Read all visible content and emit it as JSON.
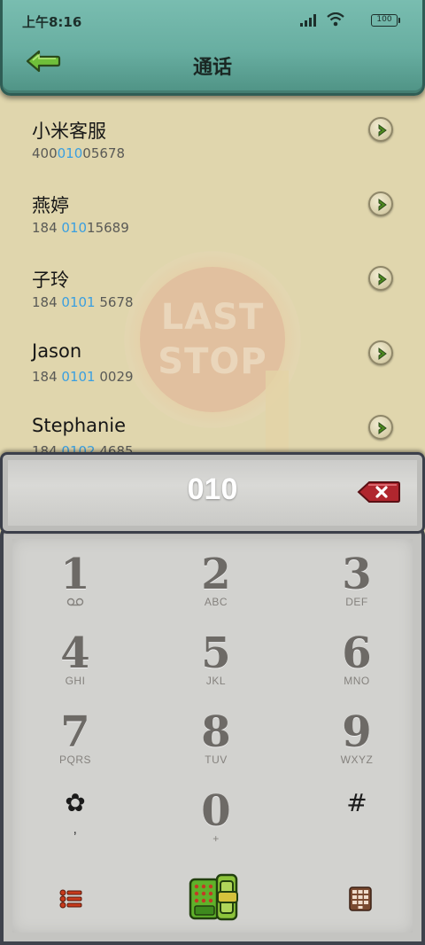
{
  "status_bar": {
    "time": "上午8:16",
    "battery": "100",
    "icons": [
      "signal-icon",
      "wifi-icon",
      "battery-icon"
    ]
  },
  "header": {
    "title": "通话",
    "back_icon": "back-arrow-icon"
  },
  "watermark": {
    "line1": "LAST",
    "line2": "STOP"
  },
  "contacts": [
    {
      "name": "小米客服",
      "number_pre": "400",
      "number_match": "010",
      "number_post": "05678"
    },
    {
      "name": "燕婷",
      "number_pre": "184 ",
      "number_match": "010",
      "number_post": "15689"
    },
    {
      "name": "子玲",
      "number_pre": "184 ",
      "number_match": "0101",
      "number_post": " 5678"
    },
    {
      "name": "Jason",
      "number_pre": "184 ",
      "number_match": "0101",
      "number_post": " 0029"
    },
    {
      "name": "Stephanie",
      "number_pre": "184 ",
      "number_match": "0102",
      "number_post": " 4685"
    }
  ],
  "dialer": {
    "input": "010",
    "delete_icon": "backspace-icon"
  },
  "keypad": {
    "keys": [
      {
        "digit": "1",
        "letters": ""
      },
      {
        "digit": "2",
        "letters": "ABC"
      },
      {
        "digit": "3",
        "letters": "DEF"
      },
      {
        "digit": "4",
        "letters": "GHI"
      },
      {
        "digit": "5",
        "letters": "JKL"
      },
      {
        "digit": "6",
        "letters": "MNO"
      },
      {
        "digit": "7",
        "letters": "PQRS"
      },
      {
        "digit": "8",
        "letters": "TUV"
      },
      {
        "digit": "9",
        "letters": "WXYZ"
      },
      {
        "digit": "✿",
        "letters": ","
      },
      {
        "digit": "0",
        "letters": "+"
      },
      {
        "digit": "#",
        "letters": ""
      }
    ]
  },
  "actions": {
    "menu_icon": "menu-list-icon",
    "call_icon": "call-phone-icon",
    "keypad_icon": "keypad-toggle-icon"
  },
  "colors": {
    "header": "#68aea1",
    "list_bg": "#e0d6ad",
    "highlight": "#3a9fe0",
    "delete": "#b0262e"
  }
}
